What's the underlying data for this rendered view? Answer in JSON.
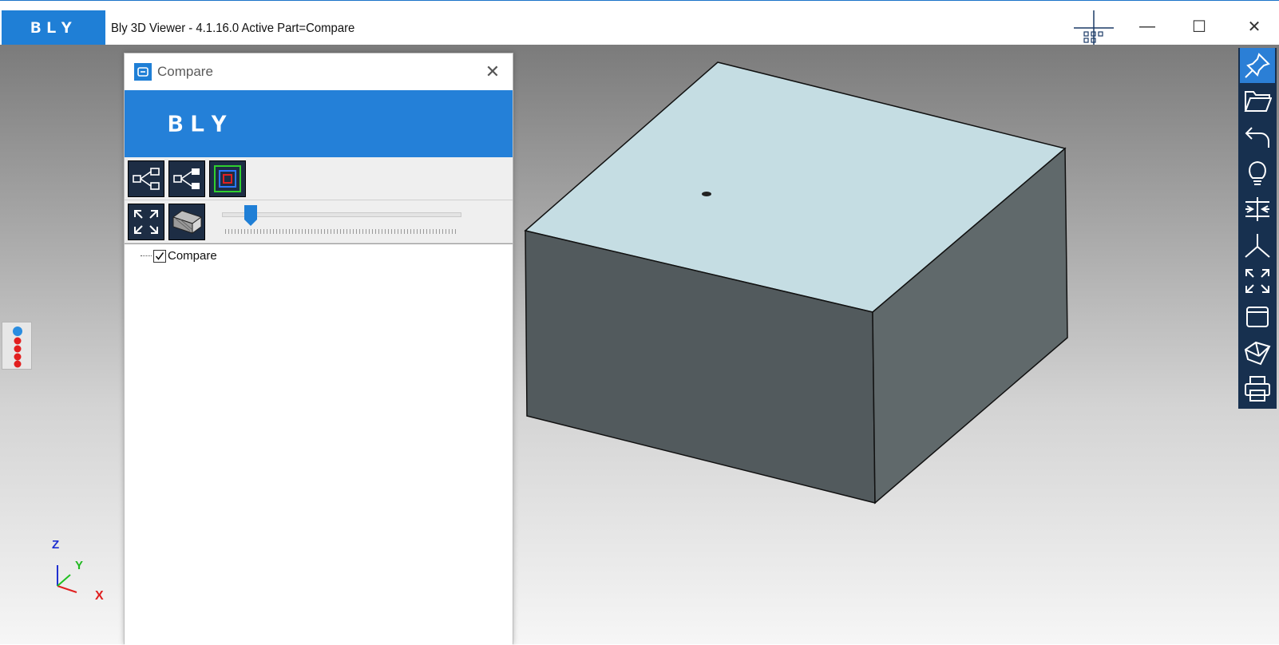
{
  "window": {
    "logo": "BLY",
    "title": "Bly 3D Viewer - 4.1.16.0 Active Part=Compare",
    "controls": {
      "minimize": "—",
      "maximize": "☐",
      "close": "✕"
    }
  },
  "panel": {
    "title": "Compare",
    "close": "✕",
    "banner_logo": "BLY",
    "toolbar1": [
      "tree-expand-icon",
      "tree-collapse-icon",
      "layers-icon"
    ],
    "toolbar2": [
      "fit-view-icon",
      "box-transparency-icon"
    ],
    "slider": {
      "value": 0.12
    },
    "tree": [
      {
        "label": "Compare",
        "checked": true
      }
    ]
  },
  "right_toolbar": [
    {
      "name": "pin-icon",
      "active": true
    },
    {
      "name": "folder-open-icon",
      "active": false
    },
    {
      "name": "undo-icon",
      "active": false
    },
    {
      "name": "lightbulb-icon",
      "active": false
    },
    {
      "name": "compare-icon",
      "active": false
    },
    {
      "name": "axis-icon",
      "active": false
    },
    {
      "name": "fit-view-icon",
      "active": false
    },
    {
      "name": "window-icon",
      "active": false
    },
    {
      "name": "section-icon",
      "active": false
    },
    {
      "name": "print-icon",
      "active": false
    }
  ],
  "axis_labels": {
    "x": "X",
    "y": "Y",
    "z": "Z"
  },
  "colors": {
    "accent": "#1f7fd6",
    "toolbar_dark": "#17304f",
    "box_top": "#c5dde3",
    "box_left": "#525a5d",
    "box_right": "#60696b"
  }
}
